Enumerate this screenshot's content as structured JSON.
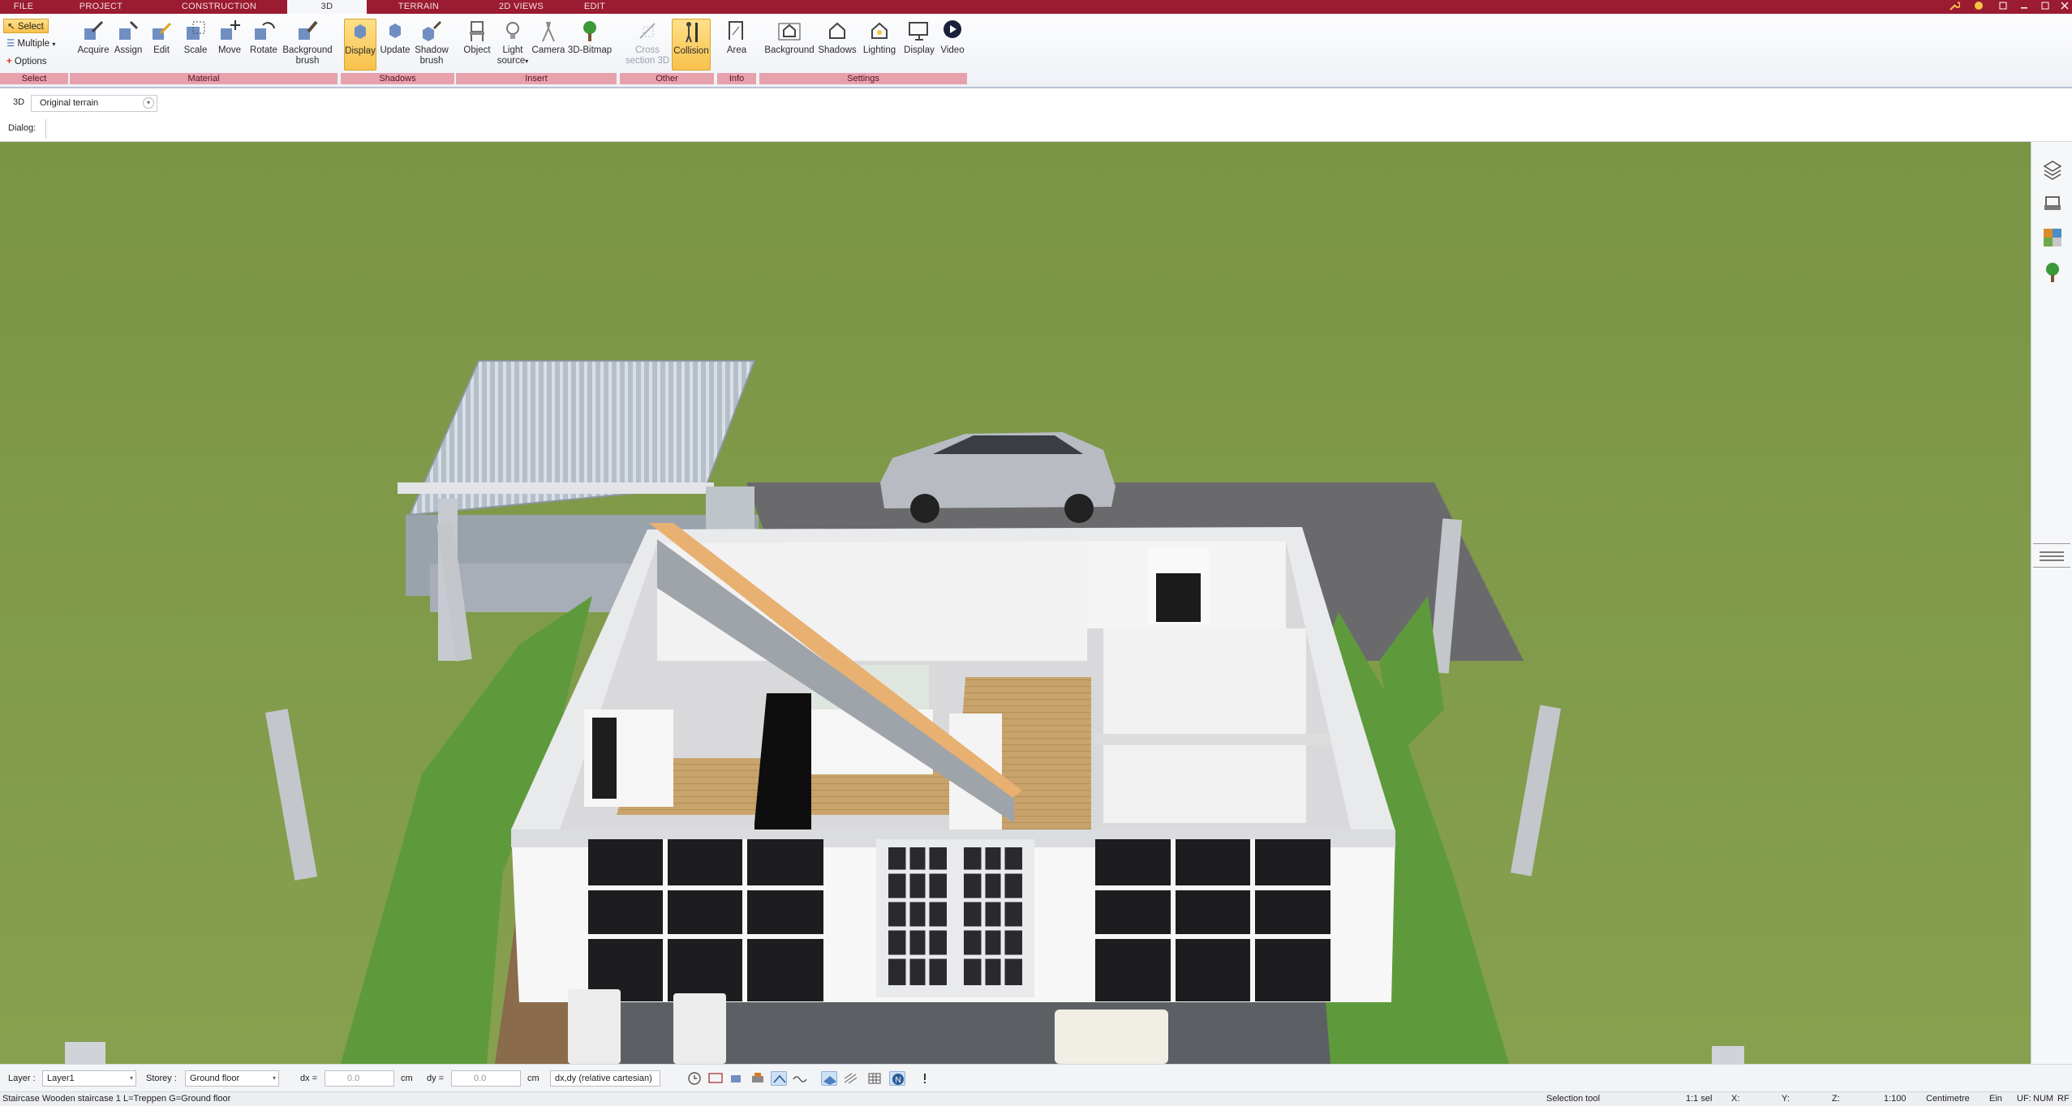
{
  "tabs": [
    "FILE",
    "PROJECT",
    "CONSTRUCTION",
    "3D",
    "TERRAIN",
    "2D VIEWS",
    "EDIT"
  ],
  "active_tab": "3D",
  "select_group": {
    "select_label": "Select",
    "multiple_label": "Multiple",
    "options_label": "Options",
    "group_label": "Select"
  },
  "material_group": {
    "buttons": [
      "Acquire",
      "Assign",
      "Edit",
      "Scale",
      "Move",
      "Rotate"
    ],
    "background_brush": [
      "Background",
      "brush"
    ],
    "group_label": "Material"
  },
  "shadows_group": {
    "display": "Display",
    "update": "Update",
    "shadow_brush": [
      "Shadow",
      "brush"
    ],
    "group_label": "Shadows"
  },
  "insert_group": {
    "object": "Object",
    "light_source": [
      "Light",
      "source"
    ],
    "camera": "Camera",
    "bitmap": "3D-Bitmap",
    "group_label": "Insert"
  },
  "other_group": {
    "cross_section": [
      "Cross",
      "section 3D"
    ],
    "collision": "Collision",
    "group_label": "Other"
  },
  "info_group": {
    "area": "Area",
    "group_label": "Info"
  },
  "settings_group": {
    "buttons": [
      "Background",
      "Shadows",
      "Lighting",
      "Display",
      "Video"
    ],
    "group_label": "Settings"
  },
  "viewbar": {
    "mode": "3D",
    "terrain_select": "Original terrain"
  },
  "dialog": {
    "label": "Dialog:"
  },
  "inputbar": {
    "layer_label": "Layer :",
    "layer_value": "Layer1",
    "storey_label": "Storey :",
    "storey_value": "Ground floor",
    "dx_label": "dx =",
    "dx_value": "0.0",
    "dx_unit": "cm",
    "dy_label": "dy =",
    "dy_value": "0.0",
    "dy_unit": "cm",
    "coord_mode": "dx,dy (relative cartesian)"
  },
  "status": {
    "message": "Staircase Wooden staircase 1 L=Treppen G=Ground floor",
    "tool": "Selection tool",
    "selection": "1:1 sel",
    "x_label": "X:",
    "y_label": "Y:",
    "z_label": "Z:",
    "scale": "1:100",
    "unit": "Centimetre",
    "ein": "Ein",
    "uf": "UF:",
    "num": "NUM",
    "rf": "RF"
  },
  "colors": {
    "tab_bar": "#9b1b30",
    "group_label_bg": "#e6a1ad",
    "highlight": "#f7c14b",
    "grass": "#7f9a4a",
    "paving": "#6a6a6c"
  }
}
